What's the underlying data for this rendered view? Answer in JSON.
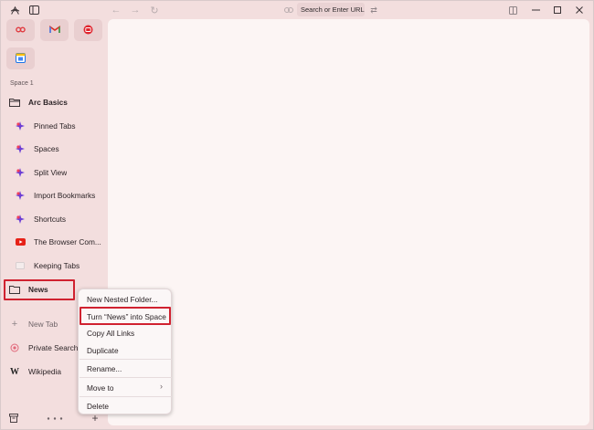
{
  "toolbar": {
    "url_placeholder": "Search or Enter URL..."
  },
  "pinned": [
    {
      "icon": "infinity-app-icon",
      "color": "#e0393e"
    },
    {
      "icon": "gmail-icon",
      "color": "#d93025"
    },
    {
      "icon": "camera-app-icon",
      "color": "#e0262f"
    },
    {
      "icon": "calendar-app-icon",
      "color": "#1a73e8"
    }
  ],
  "sidebar": {
    "space_label": "Space 1",
    "folder": "Arc Basics",
    "items": [
      {
        "label": "Pinned Tabs",
        "icon": "arc-logo-icon"
      },
      {
        "label": "Spaces",
        "icon": "arc-logo-icon"
      },
      {
        "label": "Split View",
        "icon": "arc-logo-icon"
      },
      {
        "label": "Import Bookmarks",
        "icon": "arc-logo-icon"
      },
      {
        "label": "Shortcuts",
        "icon": "arc-logo-icon"
      },
      {
        "label": "The Browser Com...",
        "icon": "youtube-icon"
      },
      {
        "label": "Keeping Tabs",
        "icon": "page-icon"
      }
    ],
    "news_folder": "News",
    "new_tab": "New Tab",
    "private_search": "Private Search Er",
    "wikipedia": "Wikipedia"
  },
  "context_menu": {
    "items": [
      "New Nested Folder...",
      "Turn “News” into Space",
      "Copy All Links",
      "Duplicate",
      "Rename...",
      "Move to",
      "Delete"
    ]
  },
  "colors": {
    "sidebar_bg": "#f3dede",
    "content_bg": "#fcf5f4",
    "highlight": "#d02230"
  }
}
